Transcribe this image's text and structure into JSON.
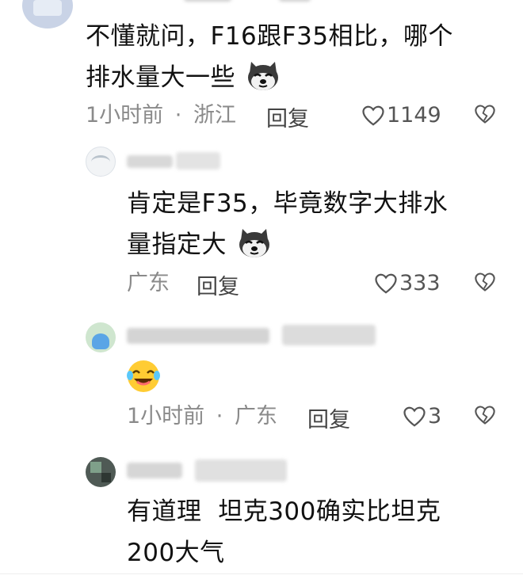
{
  "comments": [
    {
      "text_line1": "不懂就问，F16跟F35相比，哪个",
      "text_line2": "排水量大一些",
      "emoji": "doge-emoji",
      "time": "1小时前",
      "location": "浙江",
      "reply_label": "回复",
      "likes": "1149"
    },
    {
      "text_line1": "肯定是F35，毕竟数字大排水",
      "text_line2": "量指定大",
      "emoji": "doge-emoji",
      "location": "广东",
      "reply_label": "回复",
      "likes": "333"
    },
    {
      "emoji": "laughing-crying-emoji",
      "time": "1小时前",
      "location": "广东",
      "reply_label": "回复",
      "likes": "3"
    },
    {
      "text_line1": "有道理  坦克300确实比坦克",
      "text_line2": "200大气"
    }
  ],
  "meta_separator": "·",
  "icons": {
    "like": "heart-outline-icon",
    "dislike": "heart-broken-icon"
  },
  "colors": {
    "text": "#111111",
    "meta": "#8a8a8a",
    "divider": "#eeeeee"
  }
}
